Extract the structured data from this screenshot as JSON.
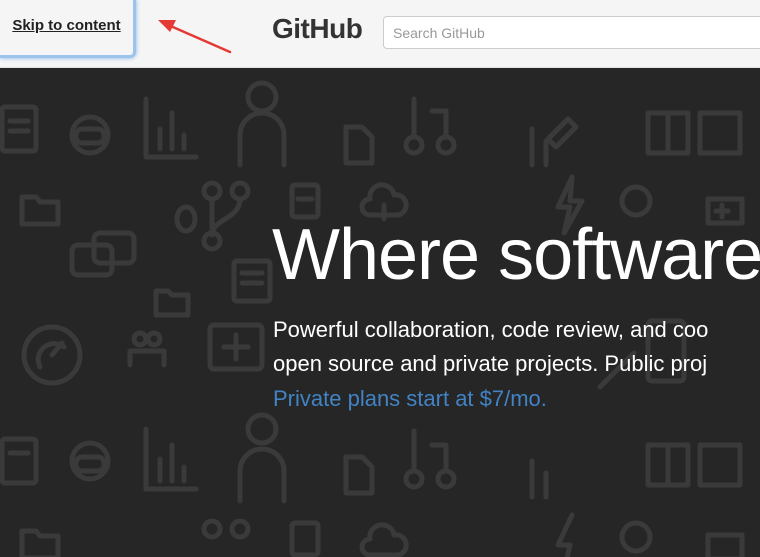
{
  "header": {
    "skip_link": "Skip to content",
    "logo": "GitHub",
    "search_placeholder": "Search GitHub"
  },
  "hero": {
    "title": "Where software",
    "lines": [
      "Powerful collaboration, code review, and coo",
      "open source and private projects. Public proj"
    ],
    "link": "Private plans start at $7/mo."
  },
  "colors": {
    "header_bg": "#f5f5f5",
    "hero_bg": "#262626",
    "link": "#4183c4",
    "annotation_arrow": "#e53935",
    "focus_outline": "#9cc3ee"
  },
  "icons": [
    "book-icon",
    "octocat-icon",
    "graph-icon",
    "people-icon",
    "file-icon",
    "pull-request-icon",
    "pencil-icon",
    "folder-icon",
    "bug-icon",
    "cloud-download-icon",
    "lightning-icon",
    "comment-icon",
    "clipboard-icon",
    "dashboard-icon",
    "plus-icon",
    "mobile-icon"
  ]
}
